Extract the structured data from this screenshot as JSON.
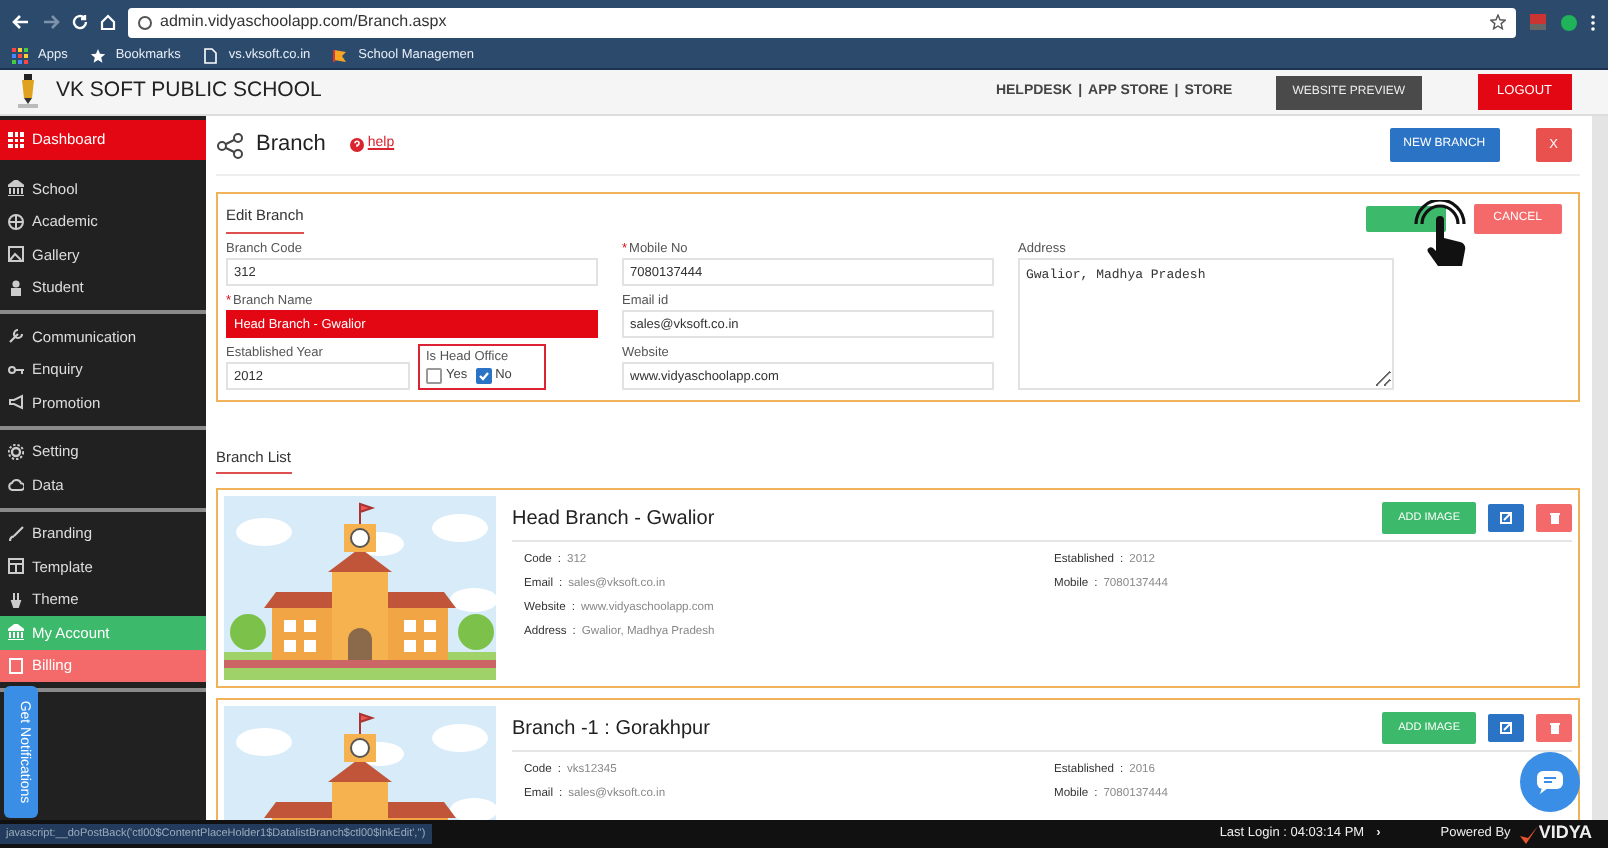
{
  "browser": {
    "url": "admin.vidyaschoolapp.com/Branch.aspx",
    "bookmarks": [
      "Apps",
      "Bookmarks",
      "vs.vksoft.co.in",
      "School Managemen"
    ]
  },
  "header": {
    "school_name": "VK SOFT PUBLIC SCHOOL",
    "links": [
      "HELPDESK",
      "APP STORE",
      "STORE"
    ],
    "separator": "|",
    "website_preview": "WEBSITE PREVIEW",
    "logout": "LOGOUT"
  },
  "sidebar": {
    "groups": [
      {
        "items": [
          {
            "label": "Dashboard",
            "selected": true
          }
        ]
      },
      {
        "items": [
          {
            "label": "School",
            "selected": false
          },
          {
            "label": "Academic",
            "selected": false
          },
          {
            "label": "Gallery",
            "selected": false
          },
          {
            "label": "Student",
            "selected": false
          }
        ]
      },
      {
        "items": [
          {
            "label": "Communication",
            "selected": false
          },
          {
            "label": "Enquiry",
            "selected": false
          },
          {
            "label": "Promotion",
            "selected": false
          }
        ]
      },
      {
        "items": [
          {
            "label": "Setting",
            "selected": false
          },
          {
            "label": "Data",
            "selected": false
          }
        ]
      },
      {
        "items": [
          {
            "label": "Branding",
            "selected": false
          },
          {
            "label": "Template",
            "selected": false
          },
          {
            "label": "Theme",
            "selected": false
          },
          {
            "label": "My Account",
            "selected": false,
            "color": "#3cb96a"
          },
          {
            "label": "Billing",
            "selected": false,
            "color": "#f46a6a"
          }
        ]
      }
    ]
  },
  "page": {
    "title": "Branch",
    "help": "help",
    "new_button": "NEW BRANCH",
    "close_button": "X"
  },
  "edit_form": {
    "title": "Edit Branch",
    "cancel": "CANCEL",
    "fields": [
      {
        "kind": "text",
        "label": "Branch Code",
        "value": "312"
      },
      {
        "kind": "text",
        "marker": "*",
        "label": "Mobile No",
        "value": "7080137444"
      },
      {
        "kind": "textarea",
        "label": "Address",
        "value": "Gwalior, Madhya Pradesh"
      },
      {
        "kind": "text",
        "marker": "*",
        "label": "Branch Name",
        "value": "Head Branch - Gwalior",
        "error": true
      },
      {
        "kind": "text",
        "label": "Email id",
        "value": "sales@vksoft.co.in"
      },
      {
        "kind": "text",
        "label": "Established Year",
        "value": "2012"
      },
      {
        "kind": "checkboxes",
        "label": "Is Head Office",
        "options": [
          {
            "label": "Yes",
            "checked": false
          },
          {
            "label": "No",
            "checked": true
          }
        ]
      },
      {
        "kind": "text",
        "label": "Website",
        "value": "www.vidyaschoolapp.com"
      }
    ]
  },
  "branch_list": {
    "title": "Branch List",
    "separator": ":",
    "branches": [
      {
        "name": "Head Branch - Gwalior",
        "add_image": "ADD IMAGE",
        "left": [
          {
            "label": "Code",
            "value": "312"
          },
          {
            "label": "Email",
            "value": "sales@vksoft.co.in"
          },
          {
            "label": "Website",
            "value": "www.vidyaschoolapp.com"
          },
          {
            "label": "Address",
            "value": "Gwalior, Madhya Pradesh"
          }
        ],
        "right": [
          {
            "label": "Established",
            "value": "2012"
          },
          {
            "label": "Mobile",
            "value": "7080137444"
          }
        ]
      },
      {
        "name": "Branch -1 : Gorakhpur",
        "add_image": "ADD IMAGE",
        "left": [
          {
            "label": "Code",
            "value": "vks12345"
          },
          {
            "label": "Email",
            "value": "sales@vksoft.co.in"
          }
        ],
        "right": [
          {
            "label": "Established",
            "value": "2016"
          },
          {
            "label": "Mobile",
            "value": "7080137444"
          }
        ]
      }
    ]
  },
  "notifications_tab": "Get Notifications",
  "status_bar": {
    "link": "javascript:__doPostBack('ctl00$ContentPlaceHolder1$DatalistBranch$ctl00$lnkEdit','')",
    "last_login": "Last Login : 04:03:14 PM",
    "chevron": "›",
    "powered_by": "Powered By",
    "brand": "VIDYA"
  }
}
